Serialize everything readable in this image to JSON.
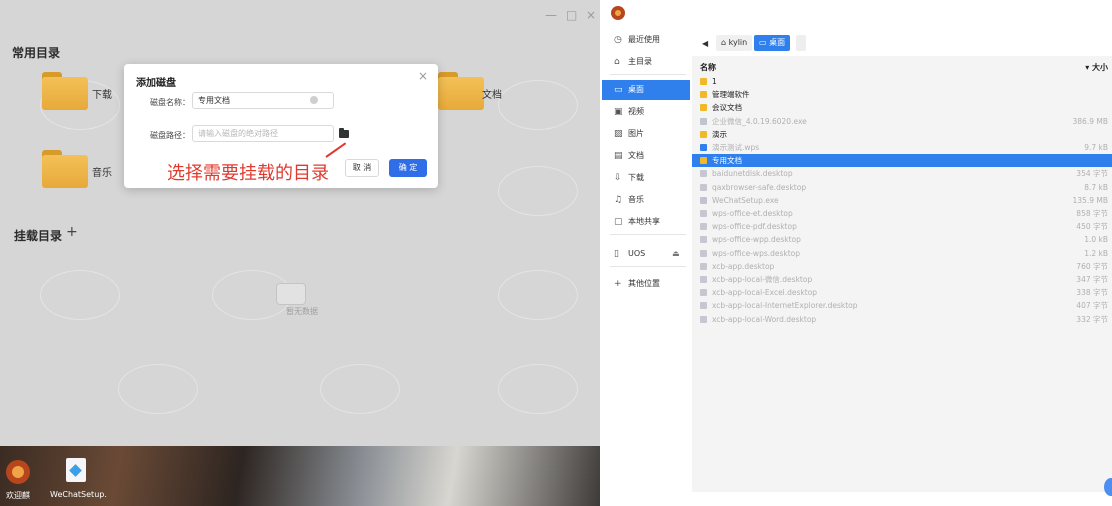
{
  "left_window": {
    "window_controls": [
      "—",
      "□",
      "×"
    ],
    "common_dirs_title": "常用目录",
    "folders": [
      {
        "label": "下载"
      },
      {
        "label": "文档"
      },
      {
        "label": "音乐"
      }
    ],
    "mounted_dirs_title": "挂载目录",
    "add_mount_symbol": "+",
    "empty_text": "暂无数据",
    "dialog": {
      "title": "添加磁盘",
      "close": "×",
      "name_label": "磁盘名称：",
      "name_value": "专用文档",
      "path_label": "磁盘路径：",
      "path_placeholder": "请输入磁盘的绝对路径",
      "cancel_label": "取 消",
      "ok_label": "确 定"
    },
    "annotation": "选择需要挂载的目录",
    "desktop_icons": [
      {
        "label": "欢迎麒"
      },
      {
        "label": "WeChatSetup."
      }
    ]
  },
  "right_window": {
    "sidebar": [
      {
        "icon": "clock-icon",
        "glyph": "◷",
        "label": "最近使用"
      },
      {
        "icon": "home-icon",
        "glyph": "⌂",
        "label": "主目录"
      },
      {
        "icon": "desktop-icon",
        "glyph": "▭",
        "label": "桌面",
        "active": true
      },
      {
        "icon": "video-icon",
        "glyph": "▣",
        "label": "视频"
      },
      {
        "icon": "picture-icon",
        "glyph": "▨",
        "label": "图片"
      },
      {
        "icon": "document-icon",
        "glyph": "▤",
        "label": "文档"
      },
      {
        "icon": "download-icon",
        "glyph": "⇩",
        "label": "下载"
      },
      {
        "icon": "music-icon",
        "glyph": "♫",
        "label": "音乐"
      },
      {
        "icon": "share-icon",
        "glyph": "▢",
        "label": "本地共享"
      },
      {
        "icon": "disk-icon",
        "glyph": "▯",
        "label": "UOS",
        "eject": "⏏"
      },
      {
        "icon": "plus-icon",
        "glyph": "+",
        "label": "其他位置"
      }
    ],
    "breadcrumb": {
      "back": "◀",
      "items": [
        {
          "label": "⌂ kylin"
        },
        {
          "label": "▭ 桌面",
          "active": true
        }
      ]
    },
    "columns": {
      "name": "名称",
      "size": "▾ 大小"
    },
    "files": [
      {
        "name": "1",
        "type": "folder",
        "size": "",
        "enabled": true
      },
      {
        "name": "管理端软件",
        "type": "folder",
        "size": "",
        "enabled": true
      },
      {
        "name": "会议文档",
        "type": "folder",
        "size": "",
        "enabled": true
      },
      {
        "name": "企业微信_4.0.19.6020.exe",
        "type": "exe",
        "size": "386.9 MB",
        "enabled": false
      },
      {
        "name": "演示",
        "type": "folder",
        "size": "",
        "enabled": true
      },
      {
        "name": "演示测试.wps",
        "type": "wps",
        "size": "9.7 kB",
        "enabled": false
      },
      {
        "name": "专用文档",
        "type": "folder",
        "size": "",
        "enabled": true,
        "selected": true
      },
      {
        "name": "baidunetdisk.desktop",
        "type": "file",
        "size": "354 字节",
        "enabled": false
      },
      {
        "name": "qaxbrowser-safe.desktop",
        "type": "file",
        "size": "8.7 kB",
        "enabled": false
      },
      {
        "name": "WeChatSetup.exe",
        "type": "exe",
        "size": "135.9 MB",
        "enabled": false
      },
      {
        "name": "wps-office-et.desktop",
        "type": "file",
        "size": "858 字节",
        "enabled": false
      },
      {
        "name": "wps-office-pdf.desktop",
        "type": "file",
        "size": "450 字节",
        "enabled": false
      },
      {
        "name": "wps-office-wpp.desktop",
        "type": "file",
        "size": "1.0 kB",
        "enabled": false
      },
      {
        "name": "wps-office-wps.desktop",
        "type": "file",
        "size": "1.2 kB",
        "enabled": false
      },
      {
        "name": "xcb-app.desktop",
        "type": "file",
        "size": "760 字节",
        "enabled": false
      },
      {
        "name": "xcb-app-local-微信.desktop",
        "type": "file",
        "size": "347 字节",
        "enabled": false
      },
      {
        "name": "xcb-app-local-Excel.desktop",
        "type": "file",
        "size": "338 字节",
        "enabled": false
      },
      {
        "name": "xcb-app-local-InternetExplorer.desktop",
        "type": "file",
        "size": "407 字节",
        "enabled": false
      },
      {
        "name": "xcb-app-local-Word.desktop",
        "type": "file",
        "size": "332 字节",
        "enabled": false
      }
    ]
  },
  "colors": {
    "accent": "#2f80ed",
    "annotation": "#e03a2f",
    "folder": "#f1b82a"
  }
}
